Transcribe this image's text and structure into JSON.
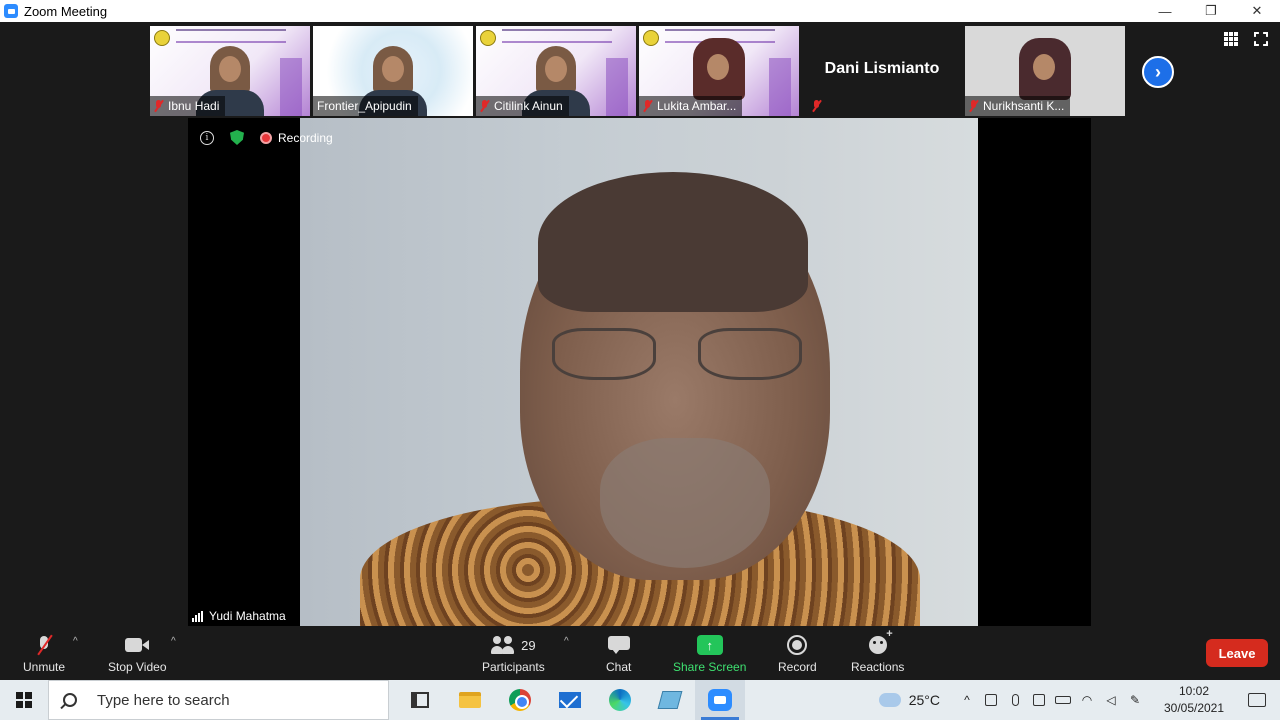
{
  "window": {
    "title": "Zoom Meeting",
    "controls": [
      "—",
      "❐",
      "✕"
    ]
  },
  "thumbnails": [
    {
      "name": "Ibnu Hadi",
      "muted": true,
      "style": "slide"
    },
    {
      "name": "Frontier_Apipudin",
      "muted": false,
      "style": "tech"
    },
    {
      "name": "Citilink Ainun",
      "muted": true,
      "style": "slide"
    },
    {
      "name": "Lukita Ambar...",
      "muted": true,
      "style": "slide-hijab"
    },
    {
      "name": "Dani Lismianto",
      "muted": true,
      "style": "name-only"
    },
    {
      "name": "Nurikhsanti K...",
      "muted": true,
      "style": "plain-hijab"
    }
  ],
  "speaker": {
    "name": "Yudi Mahatma",
    "recording_label": "Recording"
  },
  "controls": {
    "unmute": "Unmute",
    "stop_video": "Stop Video",
    "participants": "Participants",
    "participant_count": "29",
    "chat": "Chat",
    "share_screen": "Share Screen",
    "record": "Record",
    "reactions": "Reactions",
    "leave": "Leave"
  },
  "taskbar": {
    "search_placeholder": "Type here to search",
    "temperature": "25°C",
    "time": "10:02",
    "date": "30/05/2021"
  },
  "colors": {
    "leave": "#d52b1e",
    "share": "#23c55a",
    "accent": "#2d8cff"
  }
}
